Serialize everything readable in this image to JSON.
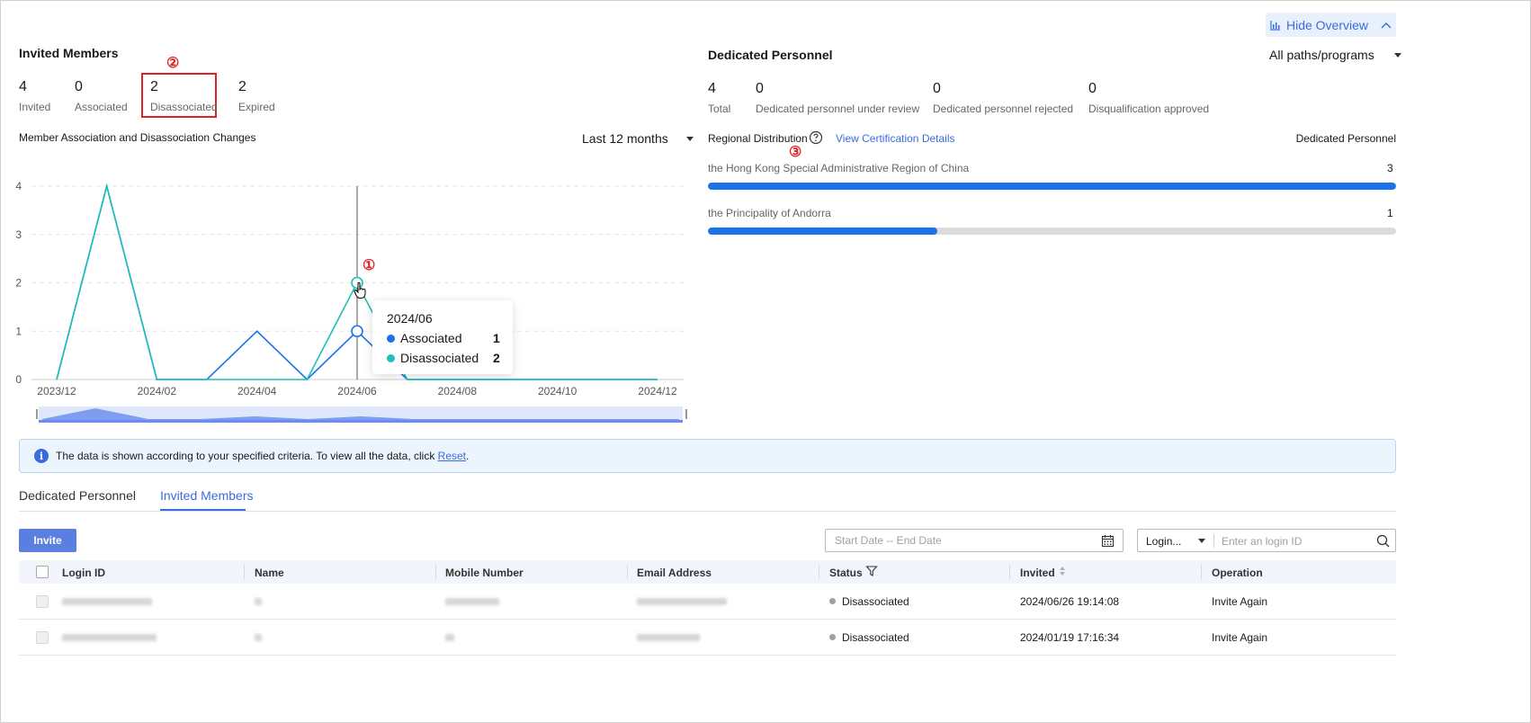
{
  "overview_button": {
    "label": "Hide Overview",
    "icon": "bar-chart-icon",
    "chevron": "chevron-up-icon"
  },
  "invited_members": {
    "title": "Invited Members",
    "marker": "②",
    "stats": [
      {
        "value": "4",
        "label": "Invited"
      },
      {
        "value": "0",
        "label": "Associated"
      },
      {
        "value": "2",
        "label": "Disassociated"
      },
      {
        "value": "2",
        "label": "Expired"
      }
    ],
    "chart_title": "Member Association and Disassociation Changes",
    "range_select": "Last 12 months"
  },
  "chart_data": {
    "type": "line",
    "x": [
      "2023/12",
      "2024/01",
      "2024/02",
      "2024/03",
      "2024/04",
      "2024/05",
      "2024/06",
      "2024/07",
      "2024/08",
      "2024/09",
      "2024/10",
      "2024/11",
      "2024/12"
    ],
    "x_tick_labels": [
      "2023/12",
      "2024/02",
      "2024/04",
      "2024/06",
      "2024/08",
      "2024/10",
      "2024/12"
    ],
    "y_ticks": [
      "0",
      "1",
      "2",
      "3",
      "4"
    ],
    "ylim": [
      0,
      4
    ],
    "grid": true,
    "series": [
      {
        "name": "Associated",
        "color": "#1a73e8",
        "values": [
          0,
          4,
          0,
          0,
          1,
          0,
          1,
          0,
          0,
          0,
          0,
          0,
          0
        ]
      },
      {
        "name": "Disassociated",
        "color": "#1fbfb8",
        "values": [
          0,
          4,
          0,
          0,
          0,
          0,
          2,
          0,
          0,
          0,
          0,
          0,
          0
        ]
      }
    ],
    "tooltip": {
      "title": "2024/06",
      "rows": [
        {
          "name": "Associated",
          "value": "1"
        },
        {
          "name": "Disassociated",
          "value": "2"
        }
      ]
    },
    "marker": "①"
  },
  "dedicated_personnel": {
    "title": "Dedicated Personnel",
    "filter": "All paths/programs",
    "stats": [
      {
        "value": "4",
        "label": "Total"
      },
      {
        "value": "0",
        "label": "Dedicated personnel under review"
      },
      {
        "value": "0",
        "label": "Dedicated personnel rejected"
      },
      {
        "value": "0",
        "label": "Disqualification approved"
      }
    ],
    "regional_label": "Regional Distribution",
    "cert_link": "View Certification Details",
    "column_label": "Dedicated Personnel",
    "marker": "③",
    "regions": [
      {
        "name": "the Hong Kong Special Administrative Region of China",
        "count": "3",
        "fraction": 1.0
      },
      {
        "name": "the Principality of Andorra",
        "count": "1",
        "fraction": 0.333
      }
    ]
  },
  "banner": {
    "text": "The data is shown according to your specified criteria. To view all the data, click ",
    "link": "Reset",
    "end": "."
  },
  "tabs": [
    {
      "label": "Dedicated Personnel"
    },
    {
      "label": "Invited Members"
    }
  ],
  "toolbar": {
    "invite_label": "Invite",
    "date_placeholder": "Start Date -- End Date",
    "login_select": "Login...",
    "search_placeholder": "Enter an login ID"
  },
  "table": {
    "headers": [
      "Login ID",
      "Name",
      "Mobile Number",
      "Email Address",
      "Status",
      "Invited",
      "Operation"
    ],
    "rows": [
      {
        "status": "Disassociated",
        "invited": "2024/06/26 19:14:08",
        "operation": "Invite Again"
      },
      {
        "status": "Disassociated",
        "invited": "2024/01/19 17:16:34",
        "operation": "Invite Again"
      }
    ]
  }
}
